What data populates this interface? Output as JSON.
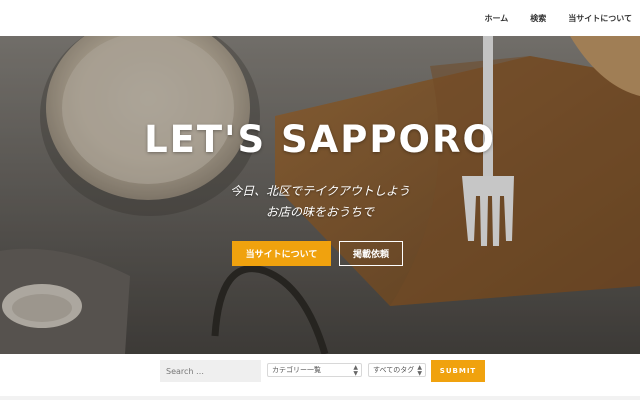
{
  "nav": {
    "items": [
      {
        "label": "ホーム"
      },
      {
        "label": "検索"
      },
      {
        "label": "当サイトについて"
      }
    ]
  },
  "hero": {
    "title": "LET'S SAPPORO",
    "subtitle_line1": "今日、北区でテイクアウトしよう",
    "subtitle_line2": "お店の味をおうちで",
    "primary_button": "当サイトについて",
    "secondary_button": "掲載依頼"
  },
  "search": {
    "placeholder": "Search …",
    "category_select": "カテゴリー一覧",
    "tag_select": "すべてのタグ",
    "submit_label": "SUBMIT"
  },
  "colors": {
    "accent": "#f0a20e",
    "nav_text": "#333333",
    "hero_text": "#ffffff"
  }
}
